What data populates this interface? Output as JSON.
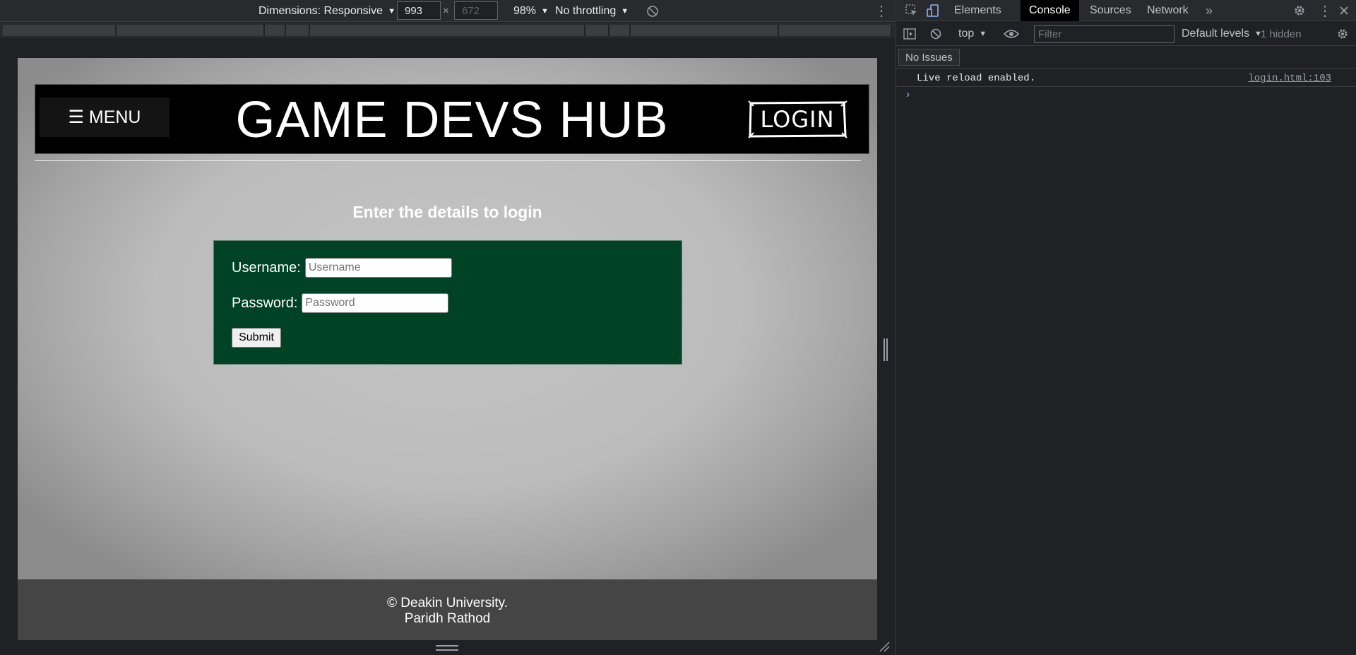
{
  "device_toolbar": {
    "dimensions_label": "Dimensions: Responsive",
    "width": "993",
    "height": "672",
    "times": "×",
    "zoom": "98%",
    "throttling": "No throttling",
    "more_icon": "⋮",
    "caret": "▼",
    "rotate_icon": "rotate-icon"
  },
  "site": {
    "menu_label": "☰ MENU",
    "title": "GAME DEVS HUB",
    "login_logo_text": "LOGIN",
    "heading": "Enter the details to login",
    "form": {
      "username_label": "Username:",
      "username_placeholder": "Username",
      "password_label": "Password:",
      "password_placeholder": "Password",
      "submit_label": "Submit"
    },
    "footer": {
      "line1": "© Deakin University.",
      "line2": "Paridh Rathod"
    },
    "colors": {
      "form_bg": "#004225",
      "header_bg": "#000000",
      "footer_bg": "#454545"
    }
  },
  "devtools": {
    "tabs": [
      "Elements",
      "Console",
      "Sources",
      "Network"
    ],
    "active_tab": "Console",
    "more_tabs": "»",
    "context": "top",
    "filter_placeholder": "Filter",
    "levels": "Default levels",
    "hidden_count": "1 hidden",
    "issues": "No Issues",
    "message": "Live reload enabled.",
    "message_source": "login.html:103",
    "prompt": "›"
  }
}
